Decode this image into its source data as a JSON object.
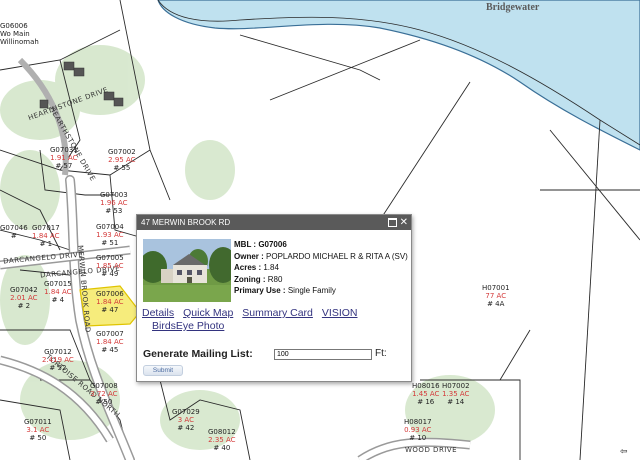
{
  "map": {
    "town_label": "Bridgewater",
    "roads": {
      "hearthstone_1": "HEARTHSTONE DRIVE",
      "hearthstone_2": "HEARTHSTONE DRIVE",
      "darcangelo_1": "DARCANGELO DRIVE",
      "darcangelo_2": "DARCANGELO DRIVE",
      "merwin": "MERWIN BROOK ROAD",
      "tortoise": "TORTOISE ROAD NORTH",
      "wood": "WOOD DRIVE"
    },
    "topleft": "G06006\nWo Main\nWillinomah",
    "parcels": [
      {
        "id": "G07031",
        "acres": "1.91 AC",
        "num": "# 57"
      },
      {
        "id": "G07002",
        "acres": "2.95 AC",
        "num": "# 55"
      },
      {
        "id": "G07003",
        "acres": "1.96 AC",
        "num": "# 53"
      },
      {
        "id": "G07004",
        "acres": "1.93 AC",
        "num": "# 51"
      },
      {
        "id": "G07017",
        "acres": "1.84 AC",
        "num": "# 1"
      },
      {
        "id": "G07046",
        "acres": "",
        "num": "#"
      },
      {
        "id": "G07005",
        "acres": "1.85 AC",
        "num": "# 49"
      },
      {
        "id": "G07042",
        "acres": "2.01 AC",
        "num": "# 2"
      },
      {
        "id": "G07015",
        "acres": "1.84 AC",
        "num": "# 4"
      },
      {
        "id": "G07006",
        "acres": "1.84 AC",
        "num": "# 47"
      },
      {
        "id": "G07007",
        "acres": "1.84 AC",
        "num": "# 45"
      },
      {
        "id": "G07012",
        "acres": "2.419 AC",
        "num": "# 52"
      },
      {
        "id": "G07008",
        "acres": "3.72 AC",
        "num": "# 50"
      },
      {
        "id": "G07011",
        "acres": "3.1 AC",
        "num": "# 50"
      },
      {
        "id": "G07029",
        "acres": "3 AC",
        "num": "# 42"
      },
      {
        "id": "G08012",
        "acres": "2.35 AC",
        "num": "# 40"
      },
      {
        "id": "H07001",
        "acres": "77 AC",
        "num": "# 4A"
      },
      {
        "id": "H08016",
        "acres": "1.45 AC",
        "num": "# 16"
      },
      {
        "id": "H07002",
        "acres": "1.35 AC",
        "num": "# 14"
      },
      {
        "id": "H08017",
        "acres": "0.93 AC",
        "num": "# 10"
      }
    ]
  },
  "popup": {
    "title": "47 MERWIN BROOK RD",
    "mbl_label": "MBL :",
    "mbl": "G07006",
    "owner_label": "Owner :",
    "owner": "POPLARDO MICHAEL R & RITA A (SV)",
    "acres_label": "Acres :",
    "acres": "1.84",
    "zoning_label": "Zoning :",
    "zoning": "R80",
    "use_label": "Primary Use :",
    "use": "Single Family",
    "links": {
      "details": "Details",
      "quick_map": "Quick Map",
      "summary_card": "Summary Card",
      "vision": "VISION",
      "birdseye": "BirdsEye Photo"
    },
    "mailing_label": "Generate Mailing List:",
    "feet_value": "100",
    "feet_unit": "Ft:",
    "submit_label": "Submit"
  },
  "colors": {
    "river": "#bfe1ef",
    "highlight": "#f6ec7c",
    "acre_text": "#d43a3a"
  },
  "icons": {
    "close": "close-icon",
    "maximize": "maximize-icon",
    "nav": "arrow-icon"
  }
}
